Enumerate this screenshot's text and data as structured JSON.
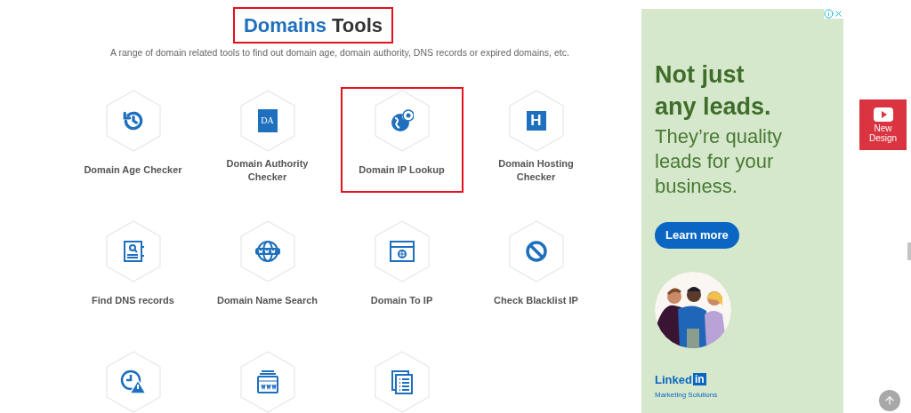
{
  "title": {
    "accent": "Domains",
    "rest": "Tools",
    "highlighted": true
  },
  "subtitle": "A range of domain related tools to find out domain age, domain authority, DNS records or expired domains, etc.",
  "tools": [
    {
      "label": "Domain Age Checker",
      "highlighted": false
    },
    {
      "label": "Domain Authority Checker",
      "highlighted": false,
      "icon_text": "DA"
    },
    {
      "label": "Domain IP Lookup",
      "highlighted": true
    },
    {
      "label": "Domain Hosting Checker",
      "highlighted": false,
      "icon_text": "H"
    },
    {
      "label": "Find DNS records",
      "highlighted": false
    },
    {
      "label": "Domain Name Search",
      "highlighted": false
    },
    {
      "label": "Domain To IP",
      "highlighted": false
    },
    {
      "label": "Check Blacklist IP",
      "highlighted": false
    },
    {
      "highlighted": false
    },
    {
      "highlighted": false
    },
    {
      "highlighted": false
    }
  ],
  "ad": {
    "headline": "Not just any leads.",
    "body": "They’re quality leads for your business.",
    "button": "Learn more",
    "brand": "Linked",
    "brand_badge": "in",
    "brand_sub": "Marketing Solutions"
  },
  "side_button": {
    "label": "New Design"
  }
}
